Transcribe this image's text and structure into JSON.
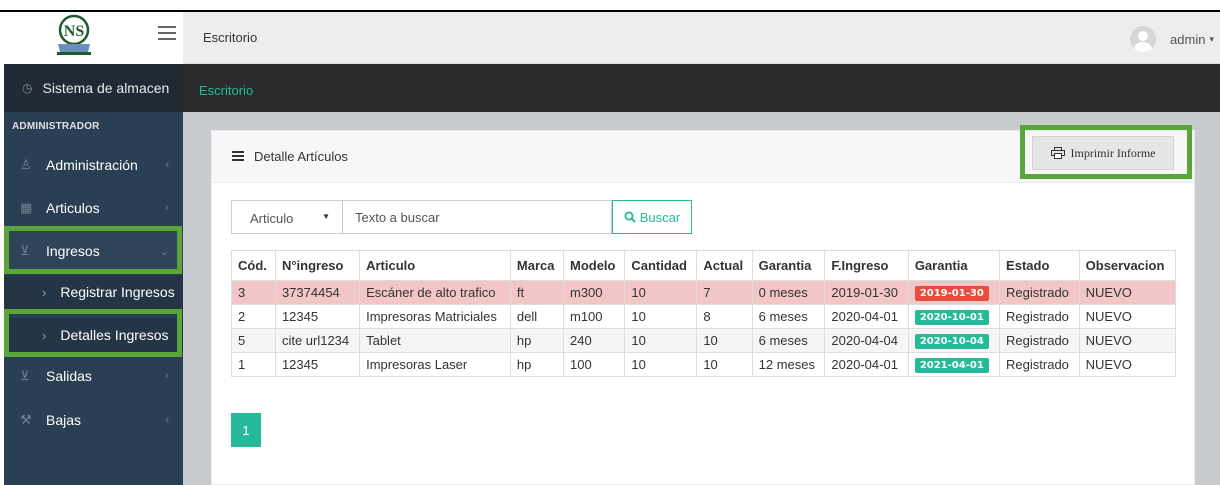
{
  "app": {
    "logo_text": "NS",
    "logo_caption": "REGIONAL LA PAZ"
  },
  "header": {
    "breadcrumb": "Escritorio",
    "user_name": "admin",
    "user_caret": "▾"
  },
  "subbar": {
    "breadcrumb": "Escritorio"
  },
  "sidebar": {
    "brand": "Sistema de almacen",
    "section": "ADMINISTRADOR",
    "items": [
      {
        "label": "Administración"
      },
      {
        "label": "Articulos"
      },
      {
        "label": "Ingresos"
      },
      {
        "label": "Salidas"
      },
      {
        "label": "Bajas"
      }
    ],
    "subitems": [
      {
        "label": "Registrar Ingresos"
      },
      {
        "label": "Detalles Ingresos"
      }
    ]
  },
  "panel": {
    "title": "Detalle Artículos",
    "print_label": "Imprimir Informe"
  },
  "search": {
    "select_value": "Articulo",
    "placeholder": "Texto a buscar",
    "button_label": "Buscar"
  },
  "table": {
    "headers": [
      "Cód.",
      "N°ingreso",
      "Articulo",
      "Marca",
      "Modelo",
      "Cantidad",
      "Actual",
      "Garantia",
      "F.Ingreso",
      "Garantia",
      "Estado",
      "Observacion"
    ],
    "rows": [
      [
        "3",
        "37374454",
        "Escáner de alto trafico",
        "ft",
        "m300",
        "10",
        "7",
        "0 meses",
        "2019-01-30",
        "2019-01-30",
        "Registrado",
        "NUEVO"
      ],
      [
        "2",
        "12345",
        "Impresoras Matriciales",
        "dell",
        "m100",
        "10",
        "8",
        "6 meses",
        "2020-04-01",
        "2020-10-01",
        "Registrado",
        "NUEVO"
      ],
      [
        "5",
        "cite url1234",
        "Tablet",
        "hp",
        "240",
        "10",
        "10",
        "6 meses",
        "2020-04-04",
        "2020-10-04",
        "Registrado",
        "NUEVO"
      ],
      [
        "1",
        "12345",
        "Impresoras Laser",
        "hp",
        "100",
        "10",
        "10",
        "12 meses",
        "2020-04-01",
        "2021-04-01",
        "Registrado",
        "NUEVO"
      ]
    ],
    "badge_colors": [
      "#e74c3c",
      "#26b99a",
      "#26b99a",
      "#26b99a"
    ]
  },
  "pagination": {
    "current": "1"
  },
  "colors": {
    "accent": "#26b99a",
    "highlight": "#5aa53a",
    "danger": "#e74c3c",
    "sidebar": "#2a3f54"
  }
}
